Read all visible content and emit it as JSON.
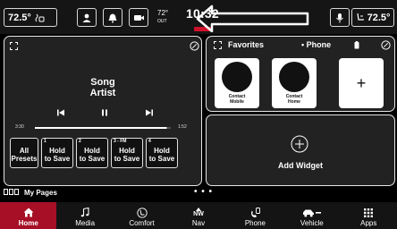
{
  "status_bar": {
    "driver_temp": "72.5°",
    "outside_temp": "72°",
    "outside_label": "OUT",
    "clock": "10:32",
    "passenger_temp": "72.5°"
  },
  "media": {
    "song": "Song",
    "artist": "Artist",
    "elapsed": "3:30",
    "remaining": "1:52",
    "progress_fraction": 0.97,
    "presets": [
      {
        "num": "",
        "line1": "All",
        "line2": "Presets"
      },
      {
        "num": "1",
        "line1": "Hold",
        "line2": "to Save"
      },
      {
        "num": "2",
        "line1": "Hold",
        "line2": "to Save"
      },
      {
        "num": "3 - FM",
        "line1": "Hold",
        "line2": "to Save"
      },
      {
        "num": "4",
        "line1": "Hold",
        "line2": "to Save"
      }
    ]
  },
  "favorites": {
    "title": "Favorites",
    "source": "• Phone",
    "contacts": [
      {
        "line1": "Contact",
        "line2": "Mobile"
      },
      {
        "line1": "Contact",
        "line2": "Home"
      }
    ],
    "add_symbol": "+"
  },
  "add_widget": {
    "label": "Add Widget"
  },
  "pages": {
    "label": "My Pages",
    "dots": "• • •"
  },
  "nav": {
    "items": [
      {
        "label": "Home",
        "icon": "home-icon"
      },
      {
        "label": "Media",
        "icon": "music-note-icon"
      },
      {
        "label": "Comfort",
        "icon": "seat-climate-icon"
      },
      {
        "label": "Nav",
        "icon": "compass-icon",
        "heading": "NW"
      },
      {
        "label": "Phone",
        "icon": "phone-icon"
      },
      {
        "label": "Vehicle",
        "icon": "car-icon"
      },
      {
        "label": "Apps",
        "icon": "apps-grid-icon"
      }
    ],
    "active": "Home"
  },
  "colors": {
    "accent": "#a60f25",
    "handle": "#d0112b",
    "panel": "#222222"
  }
}
